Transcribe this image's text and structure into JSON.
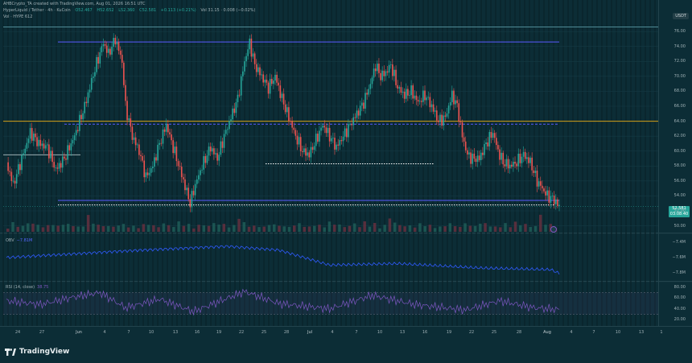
{
  "header": {
    "line1": "AHBCrypto_TA created with TradingView.com, Aug 01, 2026 16:51 UTC",
    "symbol": "HyperLiquid / Tether · 4h · KuCoin",
    "o": "O52.467",
    "h": "H52.652",
    "l": "L52.360",
    "c": "C52.581",
    "chg": "+0.113 (+0.21%)",
    "vol_label": "Vol 31.15 · 0.008 (−0.02%)",
    "line3": "Vol · HYPE 612"
  },
  "currency_tag": "USDT",
  "price_tag": {
    "price": "52.581",
    "countdown": "03:08:40"
  },
  "panes": {
    "obv_label": "OBV",
    "obv_value": "−7.81M",
    "rsi_label": "RSI (14, close)",
    "rsi_value": "38.75"
  },
  "footer": {
    "brand": "TradingView"
  },
  "chart_data": {
    "type": "candlestick",
    "symbol": "HYPEUSDT",
    "timeframe": "4h",
    "price_axis_ticks": [
      "76.00",
      "74.00",
      "72.00",
      "70.00",
      "68.00",
      "66.00",
      "64.00",
      "62.00",
      "60.00",
      "58.00",
      "56.00",
      "54.00",
      "52.00",
      "50.00"
    ],
    "obv_axis_ticks": [
      "−7.8M",
      "−7.6M",
      "−7.4M"
    ],
    "rsi_axis_ticks": [
      "80.00",
      "60.00",
      "40.00",
      "20.00"
    ],
    "x_ticks": [
      {
        "label": "24",
        "bold": false
      },
      {
        "label": "27",
        "bold": false
      },
      {
        "label": "Jun",
        "bold": true
      },
      {
        "label": "4",
        "bold": false
      },
      {
        "label": "7",
        "bold": false
      },
      {
        "label": "10",
        "bold": false
      },
      {
        "label": "13",
        "bold": false
      },
      {
        "label": "16",
        "bold": false
      },
      {
        "label": "19",
        "bold": false
      },
      {
        "label": "22",
        "bold": false
      },
      {
        "label": "25",
        "bold": false
      },
      {
        "label": "28",
        "bold": false
      },
      {
        "label": "Jul",
        "bold": true
      },
      {
        "label": "4",
        "bold": false
      },
      {
        "label": "7",
        "bold": false
      },
      {
        "label": "10",
        "bold": false
      },
      {
        "label": "13",
        "bold": false
      },
      {
        "label": "16",
        "bold": false
      },
      {
        "label": "19",
        "bold": false
      },
      {
        "label": "22",
        "bold": false
      },
      {
        "label": "25",
        "bold": false
      },
      {
        "label": "28",
        "bold": false
      },
      {
        "label": "Aug",
        "bold": true
      },
      {
        "label": "4",
        "bold": false
      },
      {
        "label": "7",
        "bold": false
      },
      {
        "label": "10",
        "bold": false
      },
      {
        "label": "13",
        "bold": false
      },
      {
        "label": "1",
        "bold": false
      }
    ],
    "price_path": [
      [
        0,
        58.5
      ],
      [
        4,
        55.5
      ],
      [
        9,
        59
      ],
      [
        14,
        62.5
      ],
      [
        19,
        61
      ],
      [
        24,
        60.5
      ],
      [
        29,
        57.5
      ],
      [
        34,
        59
      ],
      [
        40,
        62
      ],
      [
        46,
        66
      ],
      [
        52,
        71
      ],
      [
        57,
        74.5
      ],
      [
        60,
        73
      ],
      [
        64,
        75
      ],
      [
        68,
        72
      ],
      [
        70,
        66
      ],
      [
        74,
        62
      ],
      [
        78,
        60
      ],
      [
        82,
        56.5
      ],
      [
        86,
        58
      ],
      [
        90,
        61
      ],
      [
        94,
        63.5
      ],
      [
        96,
        62
      ],
      [
        100,
        59
      ],
      [
        104,
        56
      ],
      [
        108,
        53
      ],
      [
        111,
        55.5
      ],
      [
        115,
        58
      ],
      [
        120,
        60.5
      ],
      [
        124,
        59
      ],
      [
        128,
        62
      ],
      [
        132,
        64.5
      ],
      [
        136,
        67
      ],
      [
        140,
        72
      ],
      [
        143,
        74.5
      ],
      [
        146,
        71.5
      ],
      [
        150,
        70
      ],
      [
        154,
        68.5
      ],
      [
        158,
        70
      ],
      [
        162,
        67
      ],
      [
        166,
        64.5
      ],
      [
        170,
        62
      ],
      [
        174,
        60
      ],
      [
        178,
        59.5
      ],
      [
        182,
        61.5
      ],
      [
        186,
        63.5
      ],
      [
        190,
        62
      ],
      [
        194,
        60.5
      ],
      [
        198,
        62
      ],
      [
        202,
        63.5
      ],
      [
        206,
        65
      ],
      [
        210,
        66.5
      ],
      [
        214,
        69
      ],
      [
        217,
        71.5
      ],
      [
        220,
        70
      ],
      [
        223,
        70.5
      ],
      [
        226,
        71.5
      ],
      [
        230,
        68.5
      ],
      [
        234,
        67.5
      ],
      [
        238,
        68
      ],
      [
        242,
        66.5
      ],
      [
        246,
        67.5
      ],
      [
        250,
        66
      ],
      [
        254,
        64
      ],
      [
        258,
        64.5
      ],
      [
        262,
        67.5
      ],
      [
        265,
        66
      ],
      [
        268,
        62
      ],
      [
        271,
        59.5
      ],
      [
        274,
        59
      ],
      [
        278,
        59
      ],
      [
        282,
        61
      ],
      [
        286,
        62.5
      ],
      [
        289,
        60
      ],
      [
        292,
        58.5
      ],
      [
        296,
        58
      ],
      [
        300,
        58.5
      ],
      [
        304,
        59.5
      ],
      [
        308,
        58.5
      ],
      [
        312,
        56
      ],
      [
        315,
        55
      ],
      [
        318,
        54
      ],
      [
        322,
        53.5
      ],
      [
        325,
        52.5
      ]
    ],
    "volume_relative": [
      0.3,
      0.55,
      0.4,
      0.35,
      0.6,
      0.5,
      0.45,
      0.3,
      0.4,
      0.5,
      0.35,
      0.6,
      0.45,
      0.5,
      0.3,
      0.4,
      1.0,
      0.55,
      0.45,
      0.35,
      0.4,
      0.3,
      0.5,
      0.45,
      0.4,
      0.35,
      0.3,
      0.45,
      0.5,
      0.4
    ],
    "obv_path": [
      [
        0,
        -7.6
      ],
      [
        40,
        -7.55
      ],
      [
        80,
        -7.5
      ],
      [
        130,
        -7.45
      ],
      [
        160,
        -7.5
      ],
      [
        190,
        -7.7
      ],
      [
        230,
        -7.68
      ],
      [
        280,
        -7.74
      ],
      [
        320,
        -7.76
      ],
      [
        325,
        -7.81
      ]
    ],
    "rsi_path": [
      [
        0,
        55
      ],
      [
        20,
        48
      ],
      [
        40,
        62
      ],
      [
        55,
        70
      ],
      [
        70,
        42
      ],
      [
        90,
        58
      ],
      [
        110,
        35
      ],
      [
        140,
        72
      ],
      [
        160,
        50
      ],
      [
        190,
        40
      ],
      [
        215,
        65
      ],
      [
        240,
        48
      ],
      [
        270,
        38
      ],
      [
        290,
        55
      ],
      [
        310,
        42
      ],
      [
        325,
        38.75
      ]
    ],
    "horizontal_levels": [
      {
        "price": 74.6,
        "style": "solid",
        "color": "#5a5aff"
      },
      {
        "price": 64.0,
        "style": "solid",
        "color": "#d4a017"
      },
      {
        "price": 63.6,
        "style": "dashed",
        "color": "#5a5aff"
      },
      {
        "price": 59.5,
        "style": "solid",
        "color": "#9fb0b5"
      },
      {
        "price": 58.3,
        "style": "dotted",
        "color": "#ffffff"
      },
      {
        "price": 53.4,
        "style": "solid",
        "color": "#5a5aff"
      },
      {
        "price": 52.8,
        "style": "dotted",
        "color": "#ffffff"
      }
    ],
    "colors": {
      "background": "#0c2d36",
      "up": "#26a69a",
      "down": "#ef5350",
      "obv": "#2f5bff",
      "rsi": "#7e57c2",
      "level_blue": "#5a5aff",
      "level_orange": "#d4a017"
    }
  }
}
